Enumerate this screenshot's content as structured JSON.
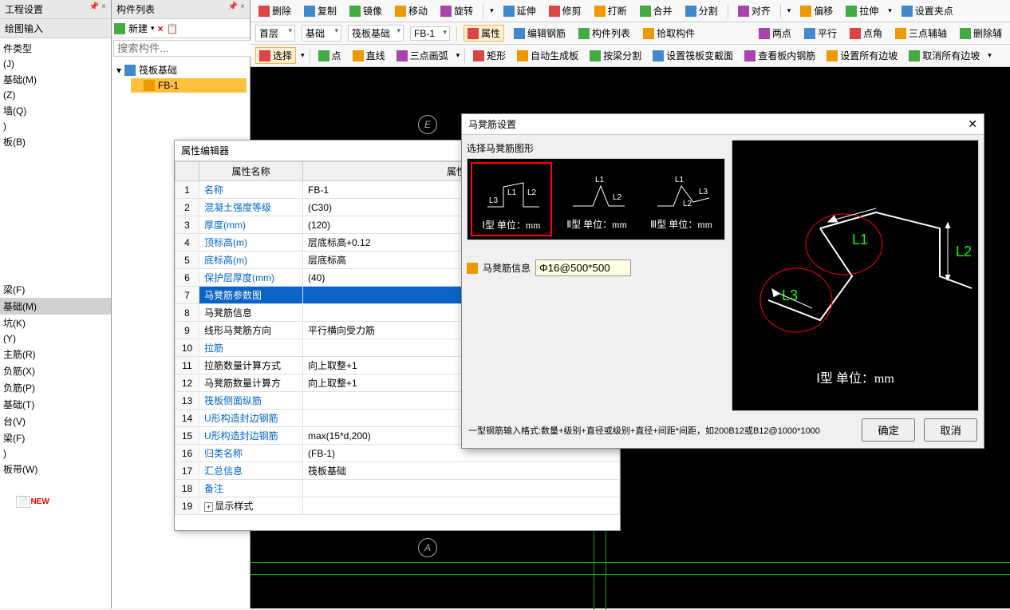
{
  "leftPanel": {
    "title1": "工程设置",
    "title2": "绘图输入",
    "pin": "📌 ×",
    "groups": {
      "items1": [
        "件类型",
        "(J)",
        "基础(M)",
        "(Z)",
        "墙(Q)",
        ")",
        "板(B)"
      ],
      "items2": [
        "梁(F)",
        "基础(M)",
        "坑(K)",
        "(Y)",
        "主筋(R)",
        "负筋(X)",
        "负筋(P)",
        "基础(T)",
        "台(V)",
        "梁(F)",
        ")",
        "板带(W)"
      ]
    },
    "newBadge": "NEW"
  },
  "midPanel": {
    "title": "构件列表",
    "pin": "📌 ×",
    "toolbar": {
      "new": "新建",
      "del": "×",
      "copy": "📋"
    },
    "searchPlaceholder": "搜索构件...",
    "tree": {
      "root": "筏板基础",
      "child": "FB-1"
    }
  },
  "topbar1": {
    "items": [
      "删除",
      "复制",
      "镜像",
      "移动",
      "旋转",
      "延伸",
      "修剪",
      "打断",
      "合并",
      "分割",
      "对齐",
      "偏移",
      "拉伸",
      "设置夹点"
    ]
  },
  "topbar2": {
    "combos": [
      "首层",
      "基础",
      "筏板基础",
      "FB-1"
    ],
    "btns": [
      "属性",
      "编辑钢筋",
      "构件列表",
      "拾取构件"
    ],
    "right": [
      "两点",
      "平行",
      "点角",
      "三点辅轴",
      "删除辅"
    ]
  },
  "topbar3": {
    "items": [
      "选择",
      "",
      "点",
      "直线",
      "三点画弧",
      "",
      "矩形",
      "自动生成板",
      "按梁分割",
      "设置筏板变截面",
      "查看板内钢筋",
      "设置所有边坡",
      "取消所有边坡"
    ]
  },
  "canvas": {
    "markE": "E",
    "markA": "A"
  },
  "propEditor": {
    "title": "属性编辑器",
    "headers": [
      "",
      "属性名称",
      "属性值"
    ],
    "rows": [
      {
        "n": "1",
        "name": "名称",
        "val": "FB-1",
        "link": true
      },
      {
        "n": "2",
        "name": "混凝土强度等级",
        "val": "(C30)",
        "link": true
      },
      {
        "n": "3",
        "name": "厚度(mm)",
        "val": "(120)",
        "link": true
      },
      {
        "n": "4",
        "name": "顶标高(m)",
        "val": "层底标高+0.12",
        "link": true
      },
      {
        "n": "5",
        "name": "底标高(m)",
        "val": "层底标高",
        "link": true
      },
      {
        "n": "6",
        "name": "保护层厚度(mm)",
        "val": "(40)",
        "link": true
      },
      {
        "n": "7",
        "name": "马凳筋参数图",
        "val": "",
        "sel": true,
        "link": true
      },
      {
        "n": "8",
        "name": "马凳筋信息",
        "val": ""
      },
      {
        "n": "9",
        "name": "线形马凳筋方向",
        "val": "平行横向受力筋"
      },
      {
        "n": "10",
        "name": "拉筋",
        "val": "",
        "link": true
      },
      {
        "n": "11",
        "name": "拉筋数量计算方式",
        "val": "向上取整+1"
      },
      {
        "n": "12",
        "name": "马凳筋数量计算方",
        "val": "向上取整+1"
      },
      {
        "n": "13",
        "name": "筏板侧面纵筋",
        "val": "",
        "link": true
      },
      {
        "n": "14",
        "name": "U形构造封边钢筋",
        "val": "",
        "link": true
      },
      {
        "n": "15",
        "name": "U形构造封边钢筋",
        "val": "max(15*d,200)",
        "link": true
      },
      {
        "n": "16",
        "name": "归类名称",
        "val": "(FB-1)",
        "link": true
      },
      {
        "n": "17",
        "name": "汇总信息",
        "val": "筏板基础",
        "link": true
      },
      {
        "n": "18",
        "name": "备注",
        "val": "",
        "link": true
      },
      {
        "n": "19",
        "name": "显示样式",
        "val": "",
        "expand": true
      }
    ]
  },
  "dialog": {
    "title": "马凳筋设置",
    "selectLabel": "选择马凳筋图形",
    "types": [
      {
        "label": "Ⅰ型 单位：mm",
        "sel": true
      },
      {
        "label": "Ⅱ型 单位：mm"
      },
      {
        "label": "Ⅲ型 单位：mm"
      }
    ],
    "infoLabel": "马凳筋信息",
    "infoValue": "Φ16@500*500",
    "previewText": "Ⅰ型 单位：mm",
    "labels": {
      "L1": "L1",
      "L2": "L2",
      "L3": "L3"
    },
    "footer": "一型钢筋输入格式:数量+级别+直径或级别+直径+间距*间距，如200B12或B12@1000*1000",
    "ok": "确定",
    "cancel": "取消"
  }
}
